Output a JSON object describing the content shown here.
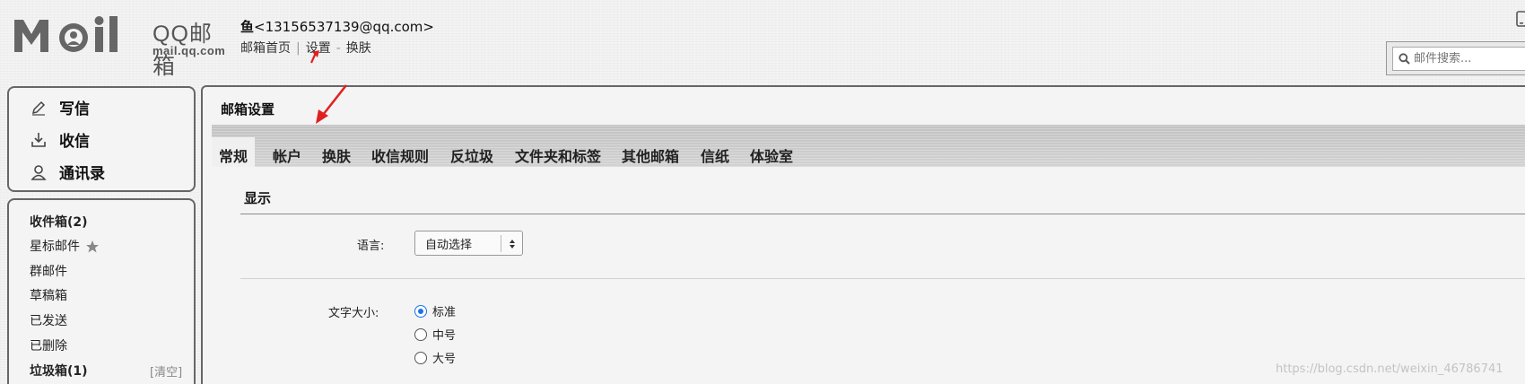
{
  "brand": {
    "title": "QQ邮箱",
    "url": "mail.qq.com"
  },
  "account": {
    "nickname": "鱼",
    "email": "<13156537139@qq.com>"
  },
  "topnav": {
    "home": "邮箱首页",
    "sep": "|",
    "settings": "设置",
    "dash": "-",
    "skin": "换肤"
  },
  "search": {
    "placeholder": "邮件搜索..."
  },
  "compose": {
    "write": "写信",
    "receive": "收信",
    "contacts": "通讯录"
  },
  "folders": {
    "inbox": "收件箱(2)",
    "starred": "星标邮件",
    "group": "群邮件",
    "drafts": "草稿箱",
    "sent": "已发送",
    "deleted": "已删除",
    "junk": "垃圾箱(1)",
    "clear": "[清空]"
  },
  "main": {
    "title": "邮箱设置",
    "tabs": [
      "常规",
      "帐户",
      "换肤",
      "收信规则",
      "反垃圾",
      "文件夹和标签",
      "其他邮箱",
      "信纸",
      "体验室"
    ],
    "active_tab": "常规"
  },
  "display": {
    "section": "显示",
    "language_label": "语言:",
    "language_value": "自动选择",
    "fontsize_label": "文字大小:",
    "fontsize_options": [
      "标准",
      "中号",
      "大号"
    ],
    "fontsize_selected": "标准"
  },
  "watermark": "https://blog.csdn.net/weixin_46786741",
  "colors": {
    "radio_accent": "#1a73e8",
    "annotation_arrow": "#e02020"
  },
  "icons": {
    "write": "pencil-icon",
    "receive": "download-icon",
    "contacts": "contact-icon",
    "search": "search-icon",
    "star": "star-icon",
    "select": "select-arrows-icon",
    "phone": "phone-icon"
  }
}
